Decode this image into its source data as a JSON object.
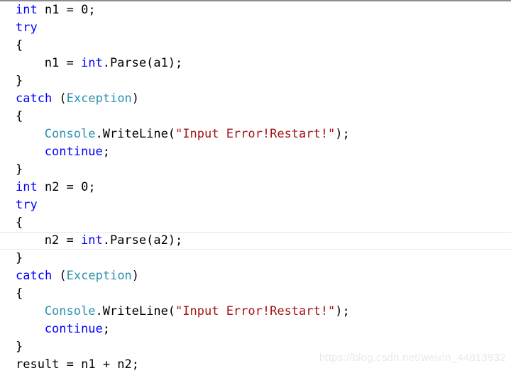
{
  "editor": {
    "language": "csharp",
    "font_size_px": 17,
    "line_height_px": 25,
    "background_color": "#FFFFFF",
    "top_rule_color": "#8C8C96",
    "current_line_index": 13,
    "current_line_border_color": "#E6E6F0",
    "colors": {
      "keyword": "#0000FF",
      "type": "#2B91AF",
      "string": "#A31515",
      "plain": "#000000",
      "watermark": "#E9E9E9"
    },
    "lines": [
      {
        "index": 0,
        "indent": 0,
        "tokens": [
          {
            "t": "int",
            "c": "kw"
          },
          {
            "t": " n1 = 0;",
            "c": "plain"
          }
        ]
      },
      {
        "index": 1,
        "indent": 0,
        "tokens": [
          {
            "t": "try",
            "c": "kw"
          }
        ]
      },
      {
        "index": 2,
        "indent": 0,
        "tokens": [
          {
            "t": "{",
            "c": "plain"
          }
        ]
      },
      {
        "index": 3,
        "indent": 4,
        "tokens": [
          {
            "t": "n1 = ",
            "c": "plain"
          },
          {
            "t": "int",
            "c": "kw"
          },
          {
            "t": ".Parse(a1);",
            "c": "plain"
          }
        ]
      },
      {
        "index": 4,
        "indent": 0,
        "tokens": [
          {
            "t": "}",
            "c": "plain"
          }
        ]
      },
      {
        "index": 5,
        "indent": 0,
        "tokens": [
          {
            "t": "catch",
            "c": "kw"
          },
          {
            "t": " (",
            "c": "plain"
          },
          {
            "t": "Exception",
            "c": "type"
          },
          {
            "t": ")",
            "c": "plain"
          }
        ]
      },
      {
        "index": 6,
        "indent": 0,
        "tokens": [
          {
            "t": "{",
            "c": "plain"
          }
        ]
      },
      {
        "index": 7,
        "indent": 4,
        "tokens": [
          {
            "t": "Console",
            "c": "type"
          },
          {
            "t": ".WriteLine(",
            "c": "plain"
          },
          {
            "t": "\"Input Error!Restart!\"",
            "c": "str"
          },
          {
            "t": ");",
            "c": "plain"
          }
        ]
      },
      {
        "index": 8,
        "indent": 4,
        "tokens": [
          {
            "t": "continue",
            "c": "kw"
          },
          {
            "t": ";",
            "c": "plain"
          }
        ]
      },
      {
        "index": 9,
        "indent": 0,
        "tokens": [
          {
            "t": "}",
            "c": "plain"
          }
        ]
      },
      {
        "index": 10,
        "indent": 0,
        "tokens": [
          {
            "t": "int",
            "c": "kw"
          },
          {
            "t": " n2 = 0;",
            "c": "plain"
          }
        ]
      },
      {
        "index": 11,
        "indent": 0,
        "tokens": [
          {
            "t": "try",
            "c": "kw"
          }
        ]
      },
      {
        "index": 12,
        "indent": 0,
        "tokens": [
          {
            "t": "{",
            "c": "plain"
          }
        ]
      },
      {
        "index": 13,
        "indent": 4,
        "tokens": [
          {
            "t": "n2 = ",
            "c": "plain"
          },
          {
            "t": "int",
            "c": "kw"
          },
          {
            "t": ".Parse(a2);",
            "c": "plain"
          }
        ]
      },
      {
        "index": 14,
        "indent": 0,
        "tokens": [
          {
            "t": "}",
            "c": "plain"
          }
        ]
      },
      {
        "index": 15,
        "indent": 0,
        "tokens": [
          {
            "t": "catch",
            "c": "kw"
          },
          {
            "t": " (",
            "c": "plain"
          },
          {
            "t": "Exception",
            "c": "type"
          },
          {
            "t": ")",
            "c": "plain"
          }
        ]
      },
      {
        "index": 16,
        "indent": 0,
        "tokens": [
          {
            "t": "{",
            "c": "plain"
          }
        ]
      },
      {
        "index": 17,
        "indent": 4,
        "tokens": [
          {
            "t": "Console",
            "c": "type"
          },
          {
            "t": ".WriteLine(",
            "c": "plain"
          },
          {
            "t": "\"Input Error!Restart!\"",
            "c": "str"
          },
          {
            "t": ");",
            "c": "plain"
          }
        ]
      },
      {
        "index": 18,
        "indent": 4,
        "tokens": [
          {
            "t": "continue",
            "c": "kw"
          },
          {
            "t": ";",
            "c": "plain"
          }
        ]
      },
      {
        "index": 19,
        "indent": 0,
        "tokens": [
          {
            "t": "}",
            "c": "plain"
          }
        ]
      },
      {
        "index": 20,
        "indent": 0,
        "tokens": [
          {
            "t": "result = n1 + n2;",
            "c": "plain"
          }
        ]
      }
    ]
  },
  "watermark": {
    "text": "https://blog.csdn.net/weixin_44813932"
  }
}
